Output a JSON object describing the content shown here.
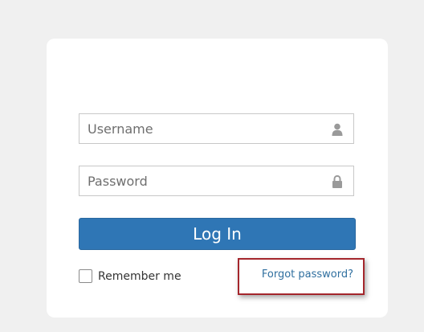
{
  "login_form": {
    "username": {
      "placeholder": "Username",
      "value": "",
      "icon": "user-icon"
    },
    "password": {
      "placeholder": "Password",
      "value": "",
      "icon": "lock-icon"
    },
    "login_button_label": "Log In",
    "remember_me_label": "Remember me",
    "remember_me_checked": false,
    "forgot_password_label": "Forgot password?"
  },
  "colors": {
    "page_background": "#f0f0f0",
    "card_background": "#ffffff",
    "primary_button": "#2f76b5",
    "link": "#2f6f9f",
    "highlight_border": "#a4262c"
  }
}
